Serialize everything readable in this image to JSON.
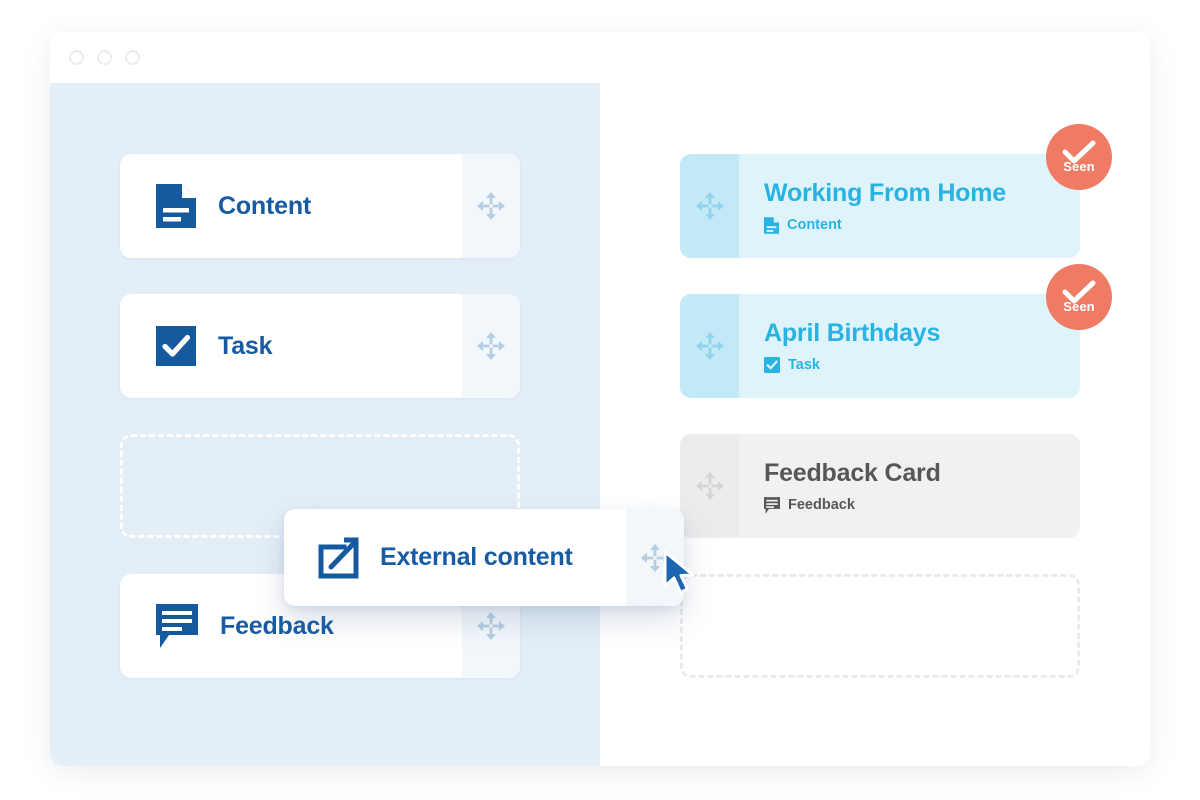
{
  "window": {
    "dots": [
      "window-dot-close",
      "window-dot-minimize",
      "window-dot-maximize"
    ]
  },
  "palette": {
    "name": "Card type palette",
    "items": [
      {
        "label": "Content",
        "icon": "document-icon",
        "handle": "move-handle-icon"
      },
      {
        "label": "Task",
        "icon": "checkbox-icon",
        "handle": "move-handle-icon"
      },
      {
        "label": "Feedback",
        "icon": "speech-bubble-icon",
        "handle": "move-handle-icon"
      }
    ],
    "placeholder": {
      "label": "",
      "state": "empty-drop-slot"
    }
  },
  "dragging": {
    "label": "External content",
    "icon": "external-link-icon",
    "handle": "move-handle-icon",
    "cursor": "arrow-cursor"
  },
  "board": {
    "name": "Card board",
    "cards": [
      {
        "title": "Working From Home",
        "type_label": "Content",
        "type_icon": "document-icon",
        "handle": "move-handle-icon",
        "state": "active",
        "badge": {
          "label": "Seen",
          "icon": "check-icon"
        }
      },
      {
        "title": "April Birthdays",
        "type_label": "Task",
        "type_icon": "checkbox-icon",
        "handle": "move-handle-icon",
        "state": "active",
        "badge": {
          "label": "Seen",
          "icon": "check-icon"
        }
      },
      {
        "title": "Feedback Card",
        "type_label": "Feedback",
        "type_icon": "speech-bubble-icon",
        "handle": "move-handle-icon",
        "state": "muted",
        "badge": null
      }
    ],
    "placeholder": {
      "label": "",
      "state": "empty-drop-slot"
    }
  },
  "colors": {
    "left_pane_bg": "#e4eef7",
    "right_pane_bg": "#ffffff",
    "palette_accent": "#175ba4",
    "board_accent": "#28b3e3",
    "board_card_bg": "#dff3fb",
    "board_handle_bg": "#c3e8f6",
    "muted_text": "#575757",
    "muted_card_bg": "#f1f1f1",
    "badge_bg": "#ef7b64",
    "handle_icon": "#b6cee2",
    "cursor": "#1d66b0"
  }
}
